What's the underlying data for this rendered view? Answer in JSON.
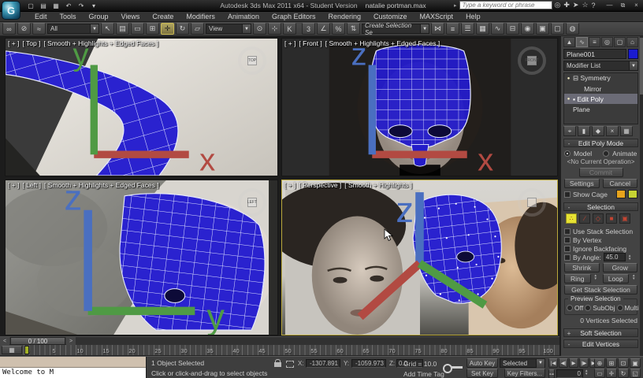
{
  "window": {
    "title_app": "Autodesk 3ds Max 2011 x64  - Student Version",
    "file_name": "natalie portman.max",
    "search_placeholder": "Type a keyword or phrase",
    "logo_glyph": "G",
    "qat_icons": [
      {
        "name": "new-scene-icon",
        "glyph": "▢"
      },
      {
        "name": "open-file-icon",
        "glyph": "▤"
      },
      {
        "name": "save-file-icon",
        "glyph": "▦"
      },
      {
        "name": "undo-icon",
        "glyph": "↶"
      },
      {
        "name": "redo-icon",
        "glyph": "↷"
      },
      {
        "name": "workspace-dropdown-icon",
        "glyph": "▾"
      }
    ],
    "search_arrow": "▸",
    "info_icons": [
      {
        "name": "search-history-icon",
        "glyph": "◎"
      },
      {
        "name": "toolbox-icon",
        "glyph": "✚"
      },
      {
        "name": "sign-in-icon",
        "glyph": "➤"
      },
      {
        "name": "favorites-star-icon",
        "glyph": "☆"
      },
      {
        "name": "help-icon",
        "glyph": "?"
      }
    ],
    "window_buttons": [
      {
        "name": "minimize-button",
        "glyph": "—"
      },
      {
        "name": "restore-button",
        "glyph": "⧉"
      },
      {
        "name": "close-button",
        "glyph": "×"
      }
    ]
  },
  "menu": {
    "items": [
      {
        "name": "menu-edit",
        "label": "Edit"
      },
      {
        "name": "menu-tools",
        "label": "Tools"
      },
      {
        "name": "menu-group",
        "label": "Group"
      },
      {
        "name": "menu-views",
        "label": "Views"
      },
      {
        "name": "menu-create",
        "label": "Create"
      },
      {
        "name": "menu-modifiers",
        "label": "Modifiers"
      },
      {
        "name": "menu-animation",
        "label": "Animation"
      },
      {
        "name": "menu-graph-editors",
        "label": "Graph Editors"
      },
      {
        "name": "menu-rendering",
        "label": "Rendering"
      },
      {
        "name": "menu-customize",
        "label": "Customize"
      },
      {
        "name": "menu-maxscript",
        "label": "MAXScript"
      },
      {
        "name": "menu-help",
        "label": "Help"
      }
    ]
  },
  "toolbar": {
    "filter_value": "All",
    "coord_value": "View",
    "selection_set_value": "Create Selection Se",
    "group1": [
      {
        "name": "select-and-link-icon",
        "glyph": "∞"
      },
      {
        "name": "unlink-selection-icon",
        "glyph": "⊘"
      },
      {
        "name": "bind-to-space-warp-icon",
        "glyph": "≈"
      }
    ],
    "group2": [
      {
        "name": "select-object-icon",
        "glyph": "↖"
      },
      {
        "name": "select-by-name-icon",
        "glyph": "▤"
      },
      {
        "name": "rectangular-selection-region-icon",
        "glyph": "▭"
      },
      {
        "name": "window-crossing-toggle-icon",
        "glyph": "⊞"
      },
      {
        "name": "select-and-move-icon",
        "glyph": "✛",
        "active": true
      },
      {
        "name": "select-and-rotate-icon",
        "glyph": "↻"
      },
      {
        "name": "select-and-uniform-scale-icon",
        "glyph": "▱"
      }
    ],
    "group3": [
      {
        "name": "use-pivot-point-center-icon",
        "glyph": "⊙"
      },
      {
        "name": "select-and-manipulate-icon",
        "glyph": "⊹"
      },
      {
        "name": "keyboard-shortcut-override-icon",
        "glyph": "K"
      }
    ],
    "group4": [
      {
        "name": "snaps-toggle-3d-icon",
        "glyph": "3"
      },
      {
        "name": "angle-snap-icon",
        "glyph": "∠"
      },
      {
        "name": "percent-snap-icon",
        "glyph": "%"
      },
      {
        "name": "spinner-snap-icon",
        "glyph": "⇅"
      }
    ],
    "group5": [
      {
        "name": "mirror-icon",
        "glyph": "⋈"
      },
      {
        "name": "align-icon",
        "glyph": "≡"
      },
      {
        "name": "layer-manager-icon",
        "glyph": "☰"
      },
      {
        "name": "graphite-modeling-tools-icon",
        "glyph": "▦"
      },
      {
        "name": "curve-editor-icon",
        "glyph": "∿"
      },
      {
        "name": "schematic-view-icon",
        "glyph": "⊟"
      },
      {
        "name": "material-editor-icon",
        "glyph": "◉"
      },
      {
        "name": "render-setup-icon",
        "glyph": "▣"
      },
      {
        "name": "rendered-frame-window-icon",
        "glyph": "▢"
      },
      {
        "name": "render-production-icon",
        "glyph": "◍"
      }
    ]
  },
  "viewports": {
    "top": {
      "plus": "[ + ]",
      "name": "[ Top ]",
      "shading": "[ Smooth + Highlights + Edged Faces ]",
      "viewcube": "TOP"
    },
    "front": {
      "plus": "[ + ]",
      "name": "[ Front ]",
      "shading": "[ Smooth + Highlights + Edged Faces ]",
      "viewcube": "FRONT"
    },
    "left": {
      "plus": "[ + ]",
      "name": "[ Left ]",
      "shading": "[ Smooth + Highlights + Edged Faces ]",
      "viewcube": "LEFT"
    },
    "perspective": {
      "plus": "[ + ]",
      "name": "[ Perspective ]",
      "shading": "[ Smooth + Highlights ]",
      "viewcube": ""
    }
  },
  "command_panel": {
    "tabs": [
      {
        "name": "tab-create",
        "glyph": "▲"
      },
      {
        "name": "tab-modify",
        "glyph": "∿",
        "active": true
      },
      {
        "name": "tab-hierarchy",
        "glyph": "≡"
      },
      {
        "name": "tab-motion",
        "glyph": "◎"
      },
      {
        "name": "tab-display",
        "glyph": "▢"
      },
      {
        "name": "tab-utilities",
        "glyph": "⌂"
      }
    ],
    "object_name": "Plane001",
    "modifier_list_label": "Modifier List",
    "stack": [
      {
        "name": "stack-item-symmetry",
        "bulb": "●",
        "label": "⊟ Symmetry"
      },
      {
        "name": "stack-item-mirror",
        "bulb": "",
        "label": "      Mirror"
      },
      {
        "name": "stack-item-edit-poly",
        "bulb": "●",
        "label": "▪ Edit Poly",
        "active": true
      },
      {
        "name": "stack-item-plane",
        "bulb": "",
        "label": "Plane"
      }
    ],
    "stack_tools": [
      {
        "name": "pin-stack-icon",
        "glyph": "⌖"
      },
      {
        "name": "show-end-result-icon",
        "glyph": "▮"
      },
      {
        "name": "make-unique-icon",
        "glyph": "◆"
      },
      {
        "name": "remove-modifier-icon",
        "glyph": "×"
      },
      {
        "name": "configure-modifier-sets-icon",
        "glyph": "▦"
      }
    ],
    "edit_poly_mode": {
      "title": "Edit Poly Mode",
      "model_label": "Model",
      "animate_label": "Animate",
      "operation": "<No Current Operation>",
      "commit_label": "Commit",
      "settings_label": "Settings",
      "cancel_label": "Cancel",
      "show_cage_label": "Show Cage"
    },
    "selection": {
      "title": "Selection",
      "subobject_icons": [
        {
          "name": "vertex-subobject-icon",
          "glyph": "∴",
          "active": true
        },
        {
          "name": "edge-subobject-icon",
          "glyph": "∕"
        },
        {
          "name": "border-subobject-icon",
          "glyph": "◇"
        },
        {
          "name": "polygon-subobject-icon",
          "glyph": "■"
        },
        {
          "name": "element-subobject-icon",
          "glyph": "▣"
        }
      ],
      "checkboxes": [
        {
          "name": "use-stack-selection-checkbox",
          "label": "Use Stack Selection"
        },
        {
          "name": "by-vertex-checkbox",
          "label": "By Vertex"
        },
        {
          "name": "ignore-backfacing-checkbox",
          "label": "Ignore Backfacing"
        }
      ],
      "by_angle_label": "By Angle:",
      "by_angle_value": "45.0",
      "shrink_label": "Shrink",
      "grow_label": "Grow",
      "ring_label": "Ring",
      "loop_label": "Loop",
      "get_stack_label": "Get Stack Selection",
      "preview_title": "Preview Selection",
      "preview_options": [
        {
          "name": "preview-off-radio",
          "label": "Off",
          "active": true
        },
        {
          "name": "preview-subobj-radio",
          "label": "SubObj"
        },
        {
          "name": "preview-multi-radio",
          "label": "Multi"
        }
      ],
      "status": "0 Vertices Selected"
    },
    "rollouts": [
      {
        "name": "soft-selection-rollout",
        "toggle": "+",
        "label": "Soft Selection"
      },
      {
        "name": "edit-vertices-rollout",
        "toggle": "-",
        "label": "Edit Vertices"
      }
    ]
  },
  "timeline": {
    "prev_label": "<",
    "value": "0 / 100",
    "next_label": ">",
    "ticks": [
      "0",
      "5",
      "10",
      "15",
      "20",
      "25",
      "30",
      "35",
      "40",
      "45",
      "50",
      "55",
      "60",
      "65",
      "70",
      "75",
      "80",
      "85",
      "90",
      "95",
      "100"
    ]
  },
  "status_bar": {
    "listener_text": "Welcome to M",
    "object_status": "1 Object Selected",
    "prompt": "Click or click-and-drag to select objects",
    "coords": {
      "x_label": "X:",
      "x": "-1307.891",
      "y_label": "Y:",
      "y": "-1059.973",
      "z_label": "Z:",
      "z": "0.0"
    },
    "grid": "Grid = 10.0",
    "add_time_tag": "Add Time Tag",
    "auto_key": "Auto Key",
    "set_key": "Set Key",
    "key_mode_value": "Selected",
    "key_filters": "Key Filters...",
    "frame": "0",
    "playback": [
      {
        "name": "go-to-start-button",
        "glyph": "|◀"
      },
      {
        "name": "previous-frame-button",
        "glyph": "◀|"
      },
      {
        "name": "play-button",
        "glyph": "▶"
      },
      {
        "name": "next-frame-button",
        "glyph": "|▶"
      },
      {
        "name": "go-to-end-button",
        "glyph": "▶|"
      }
    ],
    "key_mode_toggle_glyph": "⊶",
    "nav_row1": [
      {
        "name": "zoom-icon",
        "glyph": "⊕"
      },
      {
        "name": "zoom-all-icon",
        "glyph": "⊞"
      },
      {
        "name": "zoom-extents-icon",
        "glyph": "⊡"
      },
      {
        "name": "zoom-extents-all-icon",
        "glyph": "▣"
      }
    ],
    "nav_row2": [
      {
        "name": "zoom-region-icon",
        "glyph": "▭"
      },
      {
        "name": "pan-icon",
        "glyph": "✛"
      },
      {
        "name": "orbit-icon",
        "glyph": "↻"
      },
      {
        "name": "maximize-viewport-icon",
        "glyph": "◱"
      }
    ]
  },
  "colors": {
    "mesh_blue": "#2a22cf",
    "wireframe": "#e6e9ff",
    "active_viewport_border": "#bba93c",
    "subobject_selected": "#e6e233",
    "show_cage_orange": "#e8a41c",
    "show_cage_green": "#c6d433",
    "frame_marker_green": "#a2b126",
    "object_color_swatch": "#1a1bd0"
  }
}
